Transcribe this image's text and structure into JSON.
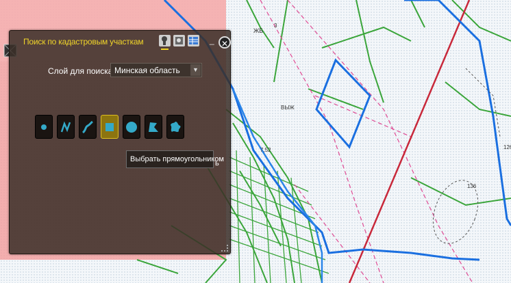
{
  "map": {
    "labels": {
      "jb": "ЖБ",
      "vyzh": "ВЫЖ",
      "num1": "3",
      "num2": "7,52",
      "num3": "126",
      "num4": "136"
    }
  },
  "panel": {
    "title": "Поиск по кадастровым участкам",
    "icons": [
      "search-by-point-icon",
      "search-by-layer-icon",
      "table-results-icon"
    ],
    "minimize_label": "_",
    "close_label": "✕"
  },
  "layer": {
    "label": "Слой для поиска:",
    "selected": "Минская область"
  },
  "tools": [
    {
      "name": "point-tool",
      "icon": "point-icon",
      "selected": false
    },
    {
      "name": "polyline-tool",
      "icon": "polyline-icon",
      "selected": false
    },
    {
      "name": "freehand-line-tool",
      "icon": "freehand-line-icon",
      "selected": false
    },
    {
      "name": "rectangle-tool",
      "icon": "rectangle-icon",
      "selected": true
    },
    {
      "name": "circle-tool",
      "icon": "circle-icon",
      "selected": false
    },
    {
      "name": "polygon-tool",
      "icon": "polygon-icon",
      "selected": false
    },
    {
      "name": "freehand-polygon-tool",
      "icon": "freehand-polygon-icon",
      "selected": false
    }
  ],
  "tooltip": {
    "text": "Выбрать прямоугольником",
    "tail": "ь"
  },
  "colors": {
    "accent": "#f0d52a",
    "tool_icon": "#34a9c8",
    "panel_bg": "#3a2e28"
  }
}
